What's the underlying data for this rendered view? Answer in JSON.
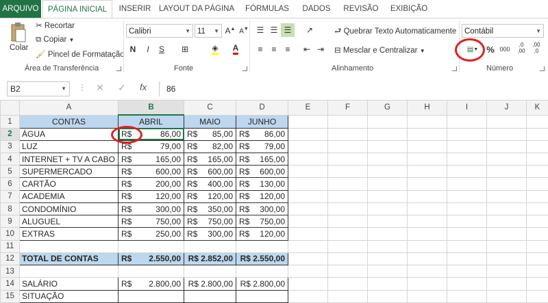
{
  "ribbon": {
    "tabs": [
      "ARQUIVO",
      "PÁGINA INICIAL",
      "INSERIR",
      "LAYOUT DA PÁGINA",
      "FÓRMULAS",
      "DADOS",
      "REVISÃO",
      "EXIBIÇÃO"
    ],
    "clipboard": {
      "paste": "Colar",
      "cut": "Recortar",
      "copy": "Copiar",
      "format_painter": "Pincel de Formatação",
      "group": "Área de Transferência"
    },
    "font": {
      "name": "Calibri",
      "size": "11",
      "bold": "N",
      "italic": "I",
      "underline": "S",
      "group": "Fonte"
    },
    "alignment": {
      "wrap": "Quebrar Texto Automaticamente",
      "merge": "Mesclar e Centralizar",
      "group": "Alinhamento"
    },
    "number": {
      "format": "Contábil",
      "percent": "%",
      "thousands": "000",
      "inc_decimal": ",0 ,00",
      "dec_decimal": ",00 ,0",
      "group": "Número"
    }
  },
  "formula_bar": {
    "name_box": "B2",
    "fx": "fx",
    "value": "86"
  },
  "columns": [
    "A",
    "B",
    "C",
    "D",
    "E",
    "F",
    "G",
    "H",
    "I",
    "J",
    "K"
  ],
  "rows": [
    {
      "n": "1",
      "a": "CONTAS",
      "b": "ABRIL",
      "c": "MAIO",
      "d": "JUNHO",
      "type": "header"
    },
    {
      "n": "2",
      "a": "ÁGUA",
      "b": "86,00",
      "c": "85,00",
      "d": "86,00"
    },
    {
      "n": "3",
      "a": "LUZ",
      "b": "79,00",
      "c": "82,00",
      "d": "79,00"
    },
    {
      "n": "4",
      "a": "INTERNET + TV A CABO",
      "b": "165,00",
      "c": "165,00",
      "d": "165,00"
    },
    {
      "n": "5",
      "a": "SUPERMERCADO",
      "b": "600,00",
      "c": "600,00",
      "d": "600,00"
    },
    {
      "n": "6",
      "a": "CARTÃO",
      "b": "200,00",
      "c": "400,00",
      "d": "130,00"
    },
    {
      "n": "7",
      "a": "ACADEMIA",
      "b": "120,00",
      "c": "120,00",
      "d": "120,00"
    },
    {
      "n": "8",
      "a": "CONDOMÍNIO",
      "b": "300,00",
      "c": "350,00",
      "d": "300,00"
    },
    {
      "n": "9",
      "a": "ALUGUEL",
      "b": "750,00",
      "c": "750,00",
      "d": "750,00"
    },
    {
      "n": "10",
      "a": "EXTRAS",
      "b": "250,00",
      "c": "300,00",
      "d": "120,00"
    },
    {
      "n": "11",
      "a": "",
      "b": "",
      "c": "",
      "d": ""
    },
    {
      "n": "12",
      "a": "TOTAL DE CONTAS",
      "b": "2.550,00",
      "c": "R$ 2.852,00",
      "d": "R$ 2.550,00",
      "type": "total"
    },
    {
      "n": "13",
      "a": "",
      "b": "",
      "c": "",
      "d": ""
    },
    {
      "n": "14",
      "a": "SALÁRIO",
      "b": "2.800,00",
      "c": "R$ 2.800,00",
      "d": "R$ 2.800,00",
      "type": "salary"
    },
    {
      "n": "15",
      "a": "SITUAÇÃO",
      "b": "",
      "c": "",
      "d": ""
    }
  ],
  "currency": "R$",
  "colors": {
    "excel_green": "#217346",
    "header_fill": "#bdd7ee",
    "highlight_circle": "#e02020"
  }
}
